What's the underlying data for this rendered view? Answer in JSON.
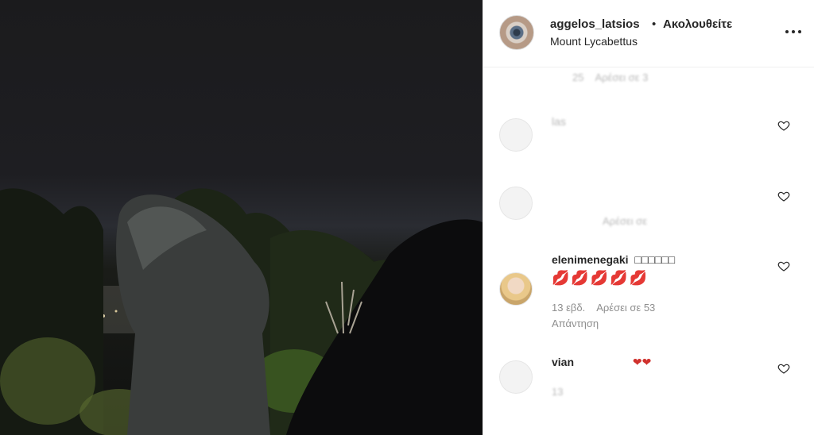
{
  "post": {
    "username": "aggelos_latsios",
    "separator": "•",
    "follow_label": "Ακολουθείτε",
    "location": "Mount Lycabettus"
  },
  "comments": [
    {
      "user": "",
      "text": "",
      "time": "25",
      "likes": "Αρέσει σε 3",
      "reply": ""
    },
    {
      "user": "las",
      "text": "",
      "time": "",
      "likes": "",
      "reply": ""
    },
    {
      "user": "",
      "text": "",
      "time": "",
      "likes": "Αρέσει σε",
      "reply": ""
    },
    {
      "user": "elenimenegaki",
      "text": "💋💋💋💋💋",
      "user_suffix": "□□□□□□",
      "time": "13 εβδ.",
      "likes": "Αρέσει σε 53",
      "reply": "Απάντηση"
    },
    {
      "user": "vian",
      "text": "",
      "time": "13",
      "likes": "",
      "reply": "",
      "emoji": "❤❤"
    }
  ],
  "icons": [
    "more-options-icon",
    "heart-icon"
  ]
}
